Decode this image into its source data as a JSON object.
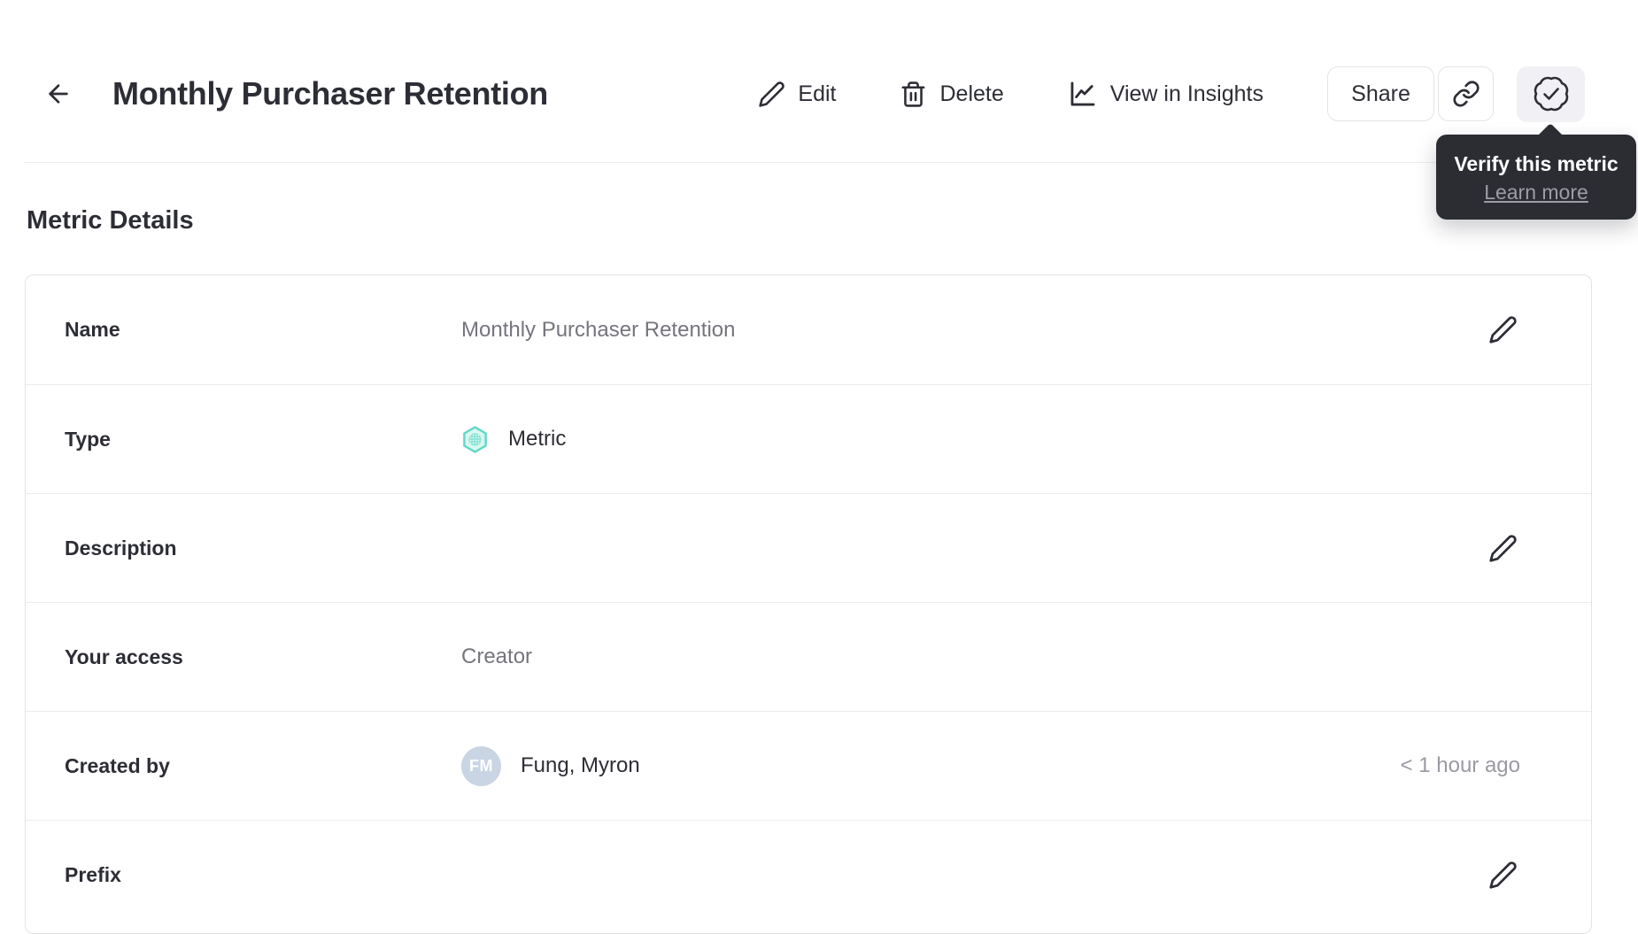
{
  "header": {
    "title": "Monthly Purchaser Retention",
    "actions": {
      "edit_label": "Edit",
      "delete_label": "Delete",
      "view_in_insights_label": "View in Insights",
      "share_label": "Share"
    }
  },
  "tooltip": {
    "title": "Verify this metric",
    "link_label": "Learn more"
  },
  "section_heading": "Metric Details",
  "details": {
    "rows": [
      {
        "label": "Name",
        "value": "Monthly Purchaser Retention"
      },
      {
        "label": "Type",
        "value": "Metric"
      },
      {
        "label": "Description",
        "value": ""
      },
      {
        "label": "Your access",
        "value": "Creator"
      },
      {
        "label": "Created by",
        "value": "Fung, Myron",
        "avatar_initials": "FM",
        "meta": "< 1 hour ago"
      },
      {
        "label": "Prefix",
        "value": ""
      }
    ]
  },
  "colors": {
    "accent_teal": "#5FD7C5",
    "teal_fill": "#D9F7F1",
    "tooltip_bg": "#2B2D33",
    "avatar_bg": "#C9D5E3",
    "badge_button_bg": "#F1F1F5"
  }
}
